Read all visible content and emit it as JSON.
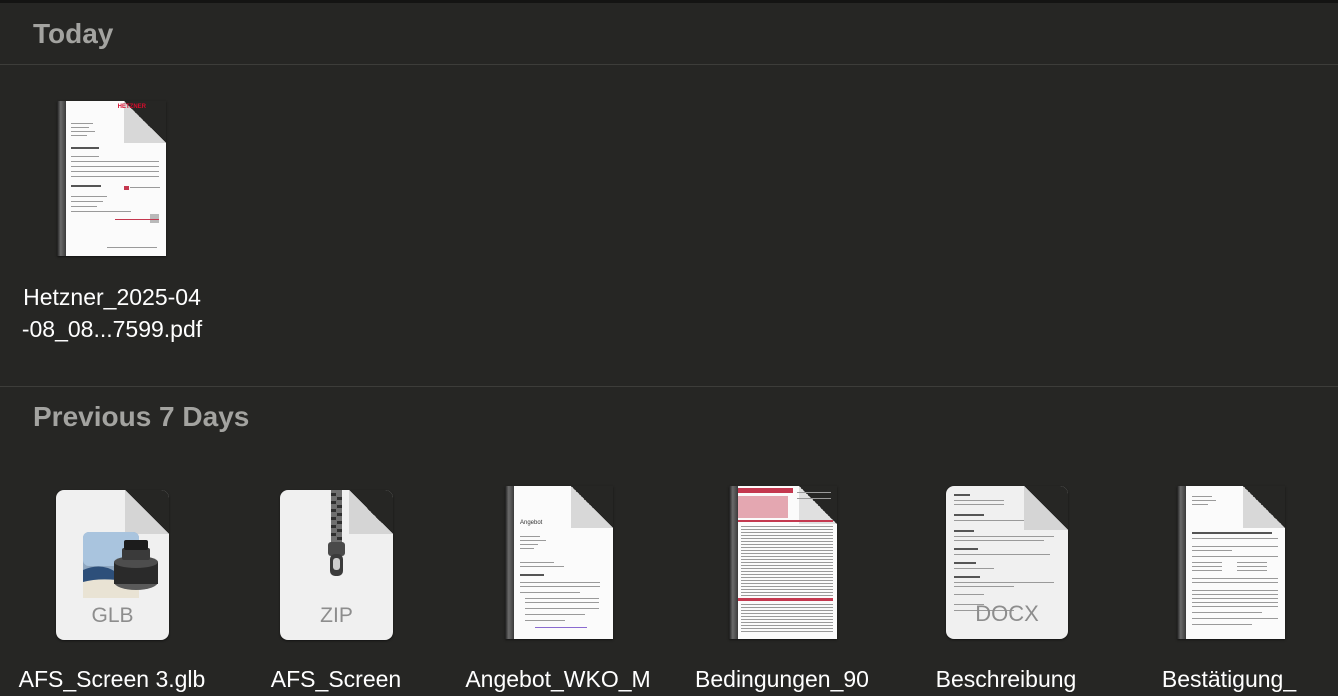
{
  "sections": [
    {
      "title": "Today"
    },
    {
      "title": "Previous 7 Days"
    }
  ],
  "today_files": [
    {
      "name_line1": "Hetzner_2025-04",
      "name_line2": "-08_08...7599.pdf",
      "icon": "pdf-thumbnail-icon",
      "thumb_brand": "HETZNER"
    }
  ],
  "recent_files": [
    {
      "name": "AFS_Screen 3.glb",
      "icon": "glb-file-icon",
      "ext": "GLB"
    },
    {
      "name": "AFS_Screen",
      "icon": "zip-archive-icon",
      "ext": "ZIP"
    },
    {
      "name": "Angebot_WKO_M",
      "icon": "pdf-thumbnail-icon",
      "thumb_heading": "Angebot"
    },
    {
      "name": "Bedingungen_90",
      "icon": "pdf-thumbnail-icon"
    },
    {
      "name": "Beschreibung",
      "icon": "docx-file-icon",
      "ext": "DOCX"
    },
    {
      "name": "Bestätigung_",
      "icon": "pdf-thumbnail-icon"
    }
  ],
  "colors": {
    "background": "#262624",
    "header_text": "#a3a3a0",
    "accent_red": "#c4384f"
  }
}
